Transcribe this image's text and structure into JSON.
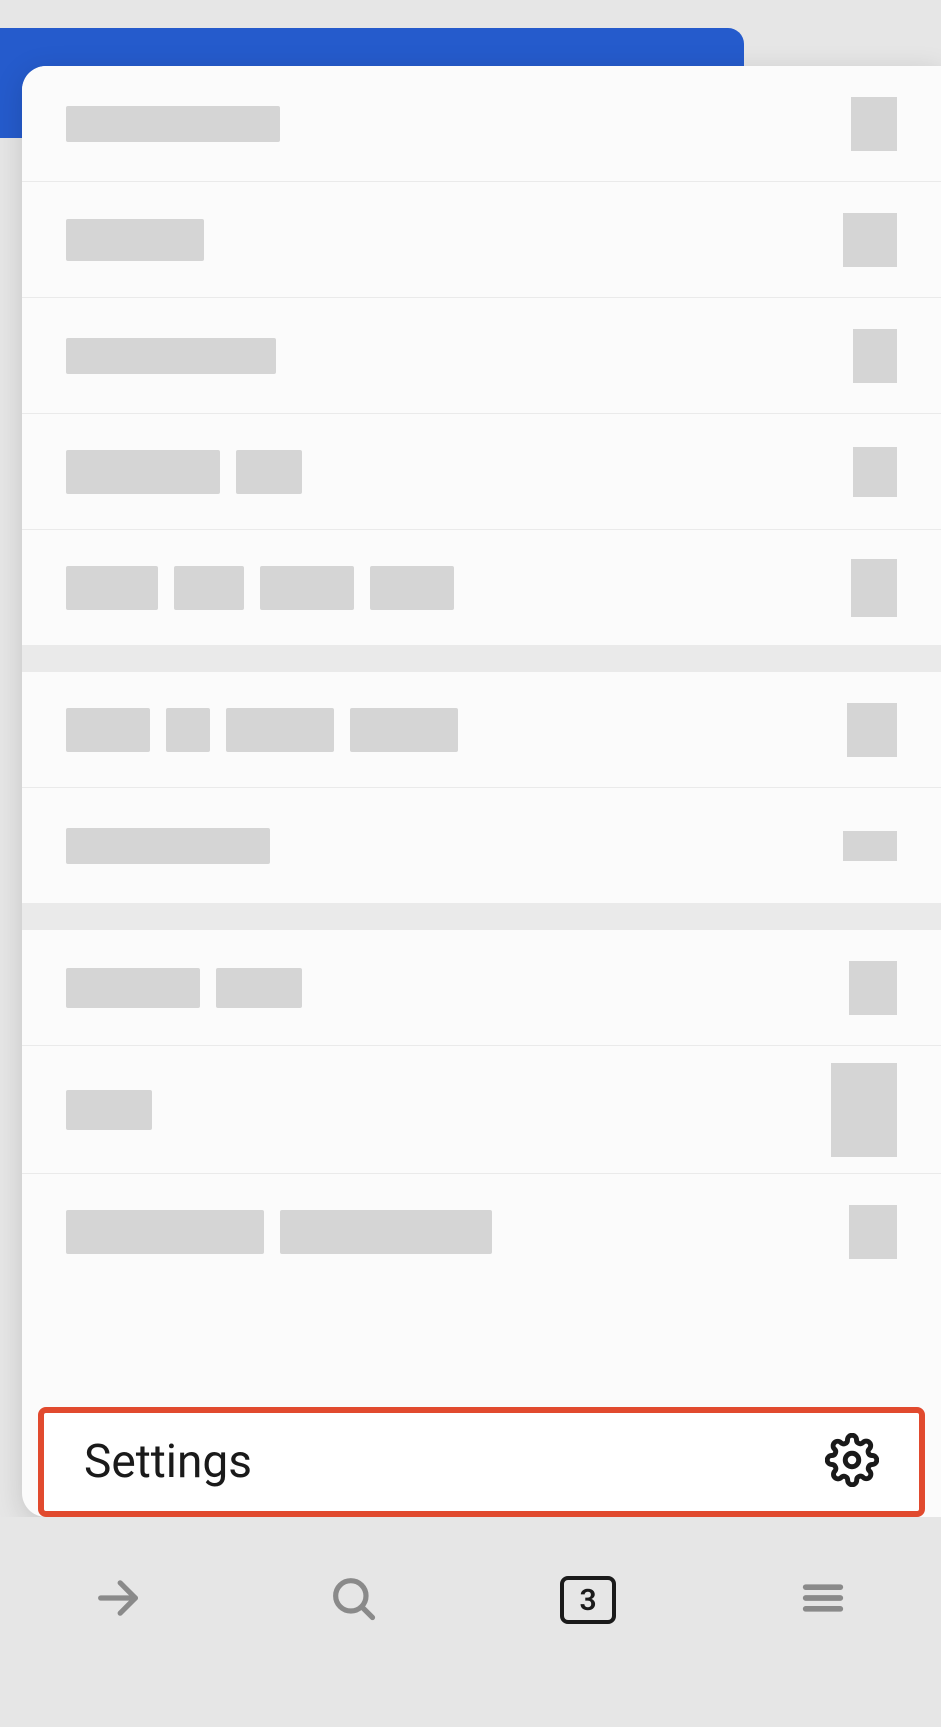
{
  "menu": {
    "settings_label": "Settings"
  },
  "toolbar": {
    "tab_count": "3"
  },
  "icons": {
    "gear": "gear-icon",
    "forward": "arrow-right-icon",
    "search": "search-icon",
    "tabs": "tabs-icon",
    "menu": "hamburger-icon"
  },
  "colors": {
    "accent_blue": "#255bcc",
    "highlight_red": "#e14a2e",
    "placeholder": "#d5d5d5"
  }
}
